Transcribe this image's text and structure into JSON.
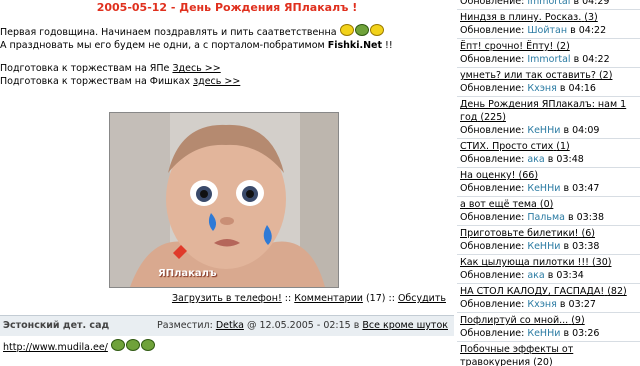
{
  "post": {
    "title": "2005-05-12 - День Рождения ЯПлакалъ !",
    "line1": "Первая годовщина. Начинаем поздравлять и пить саатветственна",
    "line2_prefix": "А праздновать мы его будем не одни, а с порталом-побратимом",
    "line2_brand": "Fishki.Net",
    "line2_suffix": "!!",
    "prep1_text": "Подготовка к торжествам на ЯПе",
    "prep1_link": "Здесь >>",
    "prep2_text": "Подготовка к торжествам на Фишках",
    "prep2_link": "здесь >>",
    "photo_watermark": "ЯПлакалъ"
  },
  "photo_links": {
    "download": "Загрузить в телефон!",
    "separator": "::",
    "comments": "Комментарии",
    "comments_count": "(17)",
    "discuss": "Обсудить"
  },
  "next_post": {
    "title": "Эстонский дет. сад",
    "posted_label": "Разместил:",
    "author": "Detka",
    "at": "@ 12.05.2005 - 02:15",
    "in_label": "в",
    "category": "Все кроме шуток",
    "url": "http://www.mudila.ee/"
  },
  "sidebar": {
    "update_label": "Обновление:",
    "in_label": "в",
    "items": [
      {
        "title": "",
        "count": "",
        "user": "immortal",
        "time": "04:29"
      },
      {
        "title": "Ниндзя в плину. Росказ.",
        "count": "(3)",
        "user": "Шойтан",
        "time": "04:22"
      },
      {
        "title": "Ёпт! срочно! Ёпту!",
        "count": "(2)",
        "user": "Immortal",
        "time": "04:22"
      },
      {
        "title": "умнеть? или так оставить?",
        "count": "(2)",
        "user": "Кхэня",
        "time": "04:16"
      },
      {
        "title": "День Рождения ЯПлакалъ: нам 1 год",
        "count": "(225)",
        "user": "КеННи",
        "time": "04:09"
      },
      {
        "title": "СТИХ. Просто стих",
        "count": "(1)",
        "user": "ака",
        "time": "03:48"
      },
      {
        "title": "На оценку!",
        "count": "(66)",
        "user": "КеННи",
        "time": "03:47"
      },
      {
        "title": "а вот ещё тема",
        "count": "(0)",
        "user": "Пальма",
        "time": "03:38"
      },
      {
        "title": "Приготовьте билетики!",
        "count": "(6)",
        "user": "КеННи",
        "time": "03:38"
      },
      {
        "title": "Как цылующа пилотки !!!",
        "count": "(30)",
        "user": "ака",
        "time": "03:34"
      },
      {
        "title": "НА СТОЛ КАЛОДУ, ГАСПАДА!",
        "count": "(82)",
        "user": "Кхэня",
        "time": "03:27"
      },
      {
        "title": "Пофлиртуй со мной...",
        "count": "(9)",
        "user": "КеННи",
        "time": "03:26"
      },
      {
        "title": "Побочные эффекты от травокурения",
        "count": "(20)",
        "user": "",
        "time": ""
      }
    ]
  }
}
